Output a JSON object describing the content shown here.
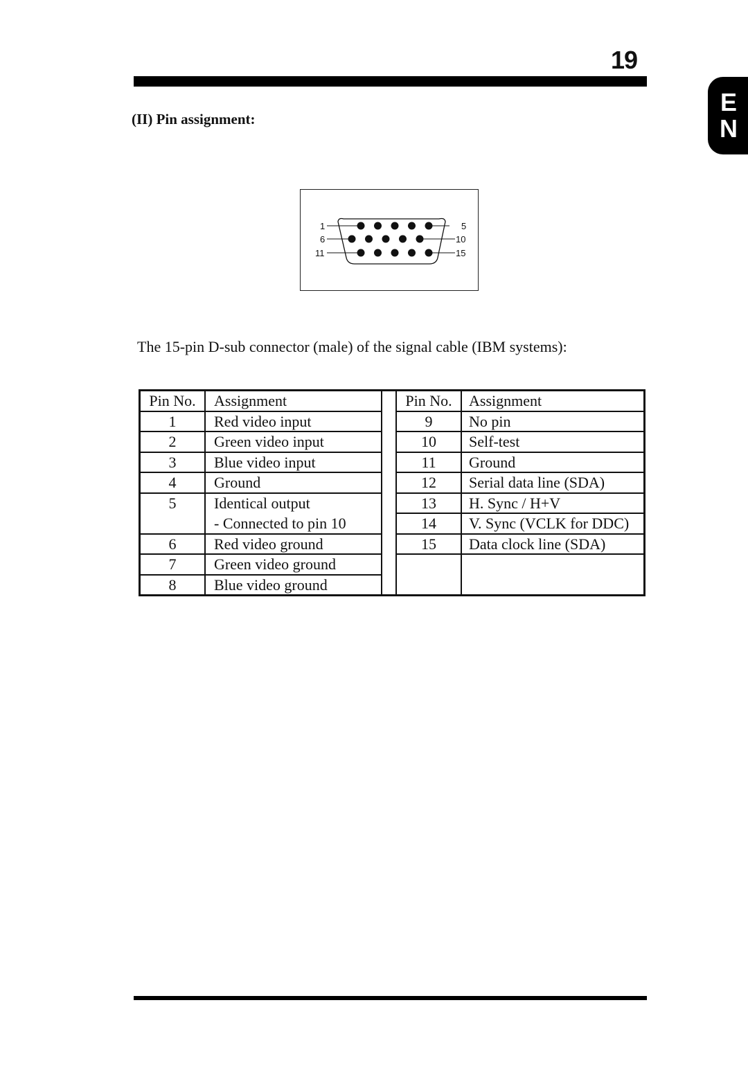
{
  "page": {
    "number": "19",
    "language_tab": [
      "E",
      "N"
    ]
  },
  "section": {
    "heading": "(II) Pin assignment:"
  },
  "connector_diagram": {
    "labels": {
      "row1_left": "1",
      "row1_right": "5",
      "row2_left": "6",
      "row2_right": "10",
      "row3_left": "11",
      "row3_right": "15"
    },
    "pins_per_row": [
      5,
      5,
      5
    ]
  },
  "caption": "The 15-pin D-sub connector (male) of the signal cable (IBM systems):",
  "table": {
    "headers": {
      "pin_no": "Pin No.",
      "assignment": "Assignment"
    },
    "left": [
      {
        "pin": "1",
        "assignment": "Red video input"
      },
      {
        "pin": "2",
        "assignment": "Green video input"
      },
      {
        "pin": "3",
        "assignment": "Blue video input"
      },
      {
        "pin": "4",
        "assignment": "Ground"
      },
      {
        "pin": "5",
        "assignment": "Identical output",
        "assignment_line2": "- Connected to pin 10"
      },
      {
        "pin": "6",
        "assignment": "Red video ground"
      },
      {
        "pin": "7",
        "assignment": "Green video ground"
      },
      {
        "pin": "8",
        "assignment": "Blue video ground"
      }
    ],
    "right": [
      {
        "pin": "9",
        "assignment": "No pin"
      },
      {
        "pin": "10",
        "assignment": "Self-test"
      },
      {
        "pin": "11",
        "assignment": "Ground"
      },
      {
        "pin": "12",
        "assignment": "Serial data line (SDA)"
      },
      {
        "pin": "13",
        "assignment": "H. Sync / H+V"
      },
      {
        "pin": "14",
        "assignment": "V. Sync (VCLK for DDC)"
      },
      {
        "pin": "15",
        "assignment": "Data clock line (SDA)"
      }
    ]
  }
}
